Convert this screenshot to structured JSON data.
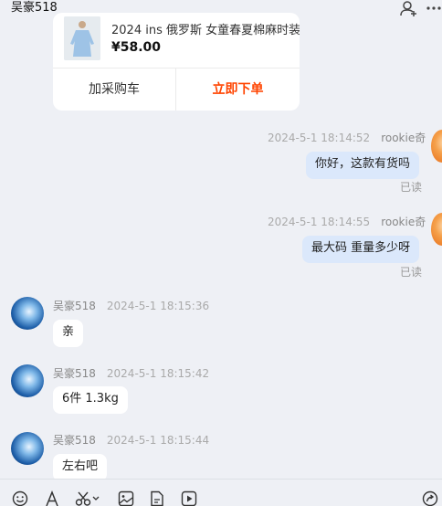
{
  "header": {
    "title": "吴豪518"
  },
  "product": {
    "name": "2024 ins 俄罗斯 女童春夏棉麻时装",
    "price": "¥58.00",
    "cart_label": "加采购车",
    "buy_label": "立即下单"
  },
  "messages": [
    {
      "sender": "rookie奇",
      "time": "2024-5-1 18:14:52",
      "text": "你好，这款有货吗",
      "status": "已读"
    },
    {
      "sender": "rookie奇",
      "time": "2024-5-1 18:14:55",
      "text": "最大码 重量多少呀",
      "status": "已读"
    },
    {
      "sender": "吴豪518",
      "time": "2024-5-1 18:15:36",
      "text": "亲"
    },
    {
      "sender": "吴豪518",
      "time": "2024-5-1 18:15:42",
      "text": "6件 1.3kg"
    },
    {
      "sender": "吴豪518",
      "time": "2024-5-1 18:15:44",
      "text": "左右吧"
    }
  ],
  "colors": {
    "background": "#eef0f5",
    "outgoing_bubble": "#dbe8fb",
    "incoming_bubble": "#ffffff",
    "buy_accent": "#ff4400"
  },
  "toolbar_icons": [
    "emoji-icon",
    "font-icon",
    "scissors-icon",
    "image-icon",
    "file-icon",
    "video-icon",
    "share-icon"
  ]
}
